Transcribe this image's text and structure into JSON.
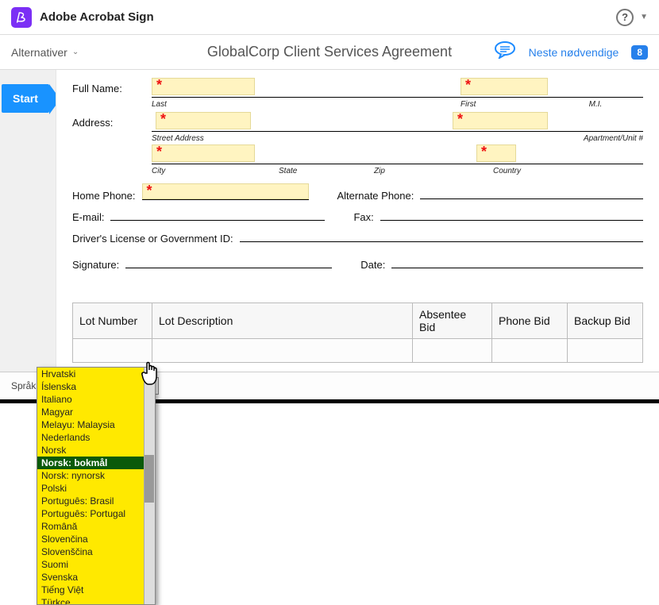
{
  "header": {
    "app_title": "Adobe Acrobat Sign"
  },
  "toolbar": {
    "alternativer": "Alternativer",
    "doc_title": "GlobalCorp Client Services Agreement",
    "next_required": "Neste nødvendige",
    "badge": "8"
  },
  "sidebar": {
    "start": "Start"
  },
  "form": {
    "full_name": "Full Name:",
    "last": "Last",
    "first": "First",
    "mi": "M.I.",
    "address": "Address:",
    "street_address": "Street Address",
    "apartment": "Apartment/Unit #",
    "city": "City",
    "state": "State",
    "zip": "Zip",
    "country": "Country",
    "home_phone": "Home Phone:",
    "alt_phone": "Alternate Phone:",
    "email": "E-mail:",
    "fax": "Fax:",
    "drivers": "Driver's License or Government ID:",
    "signature": "Signature:",
    "date": "Date:"
  },
  "table": {
    "col1": "Lot Number",
    "col2": "Lot Description",
    "col3": "Absentee Bid",
    "col4": "Phone Bid",
    "col5": "Backup Bid"
  },
  "lang": {
    "label": "Språk",
    "selected": "Norsk: bokmål",
    "options": [
      "Hrvatski",
      "Íslenska",
      "Italiano",
      "Magyar",
      "Melayu: Malaysia",
      "Nederlands",
      "Norsk",
      "Norsk: bokmål",
      "Norsk: nynorsk",
      "Polski",
      "Português: Brasil",
      "Português: Portugal",
      "Română",
      "Slovenčina",
      "Slovenščina",
      "Suomi",
      "Svenska",
      "Tiếng Việt",
      "Türkçe"
    ]
  }
}
